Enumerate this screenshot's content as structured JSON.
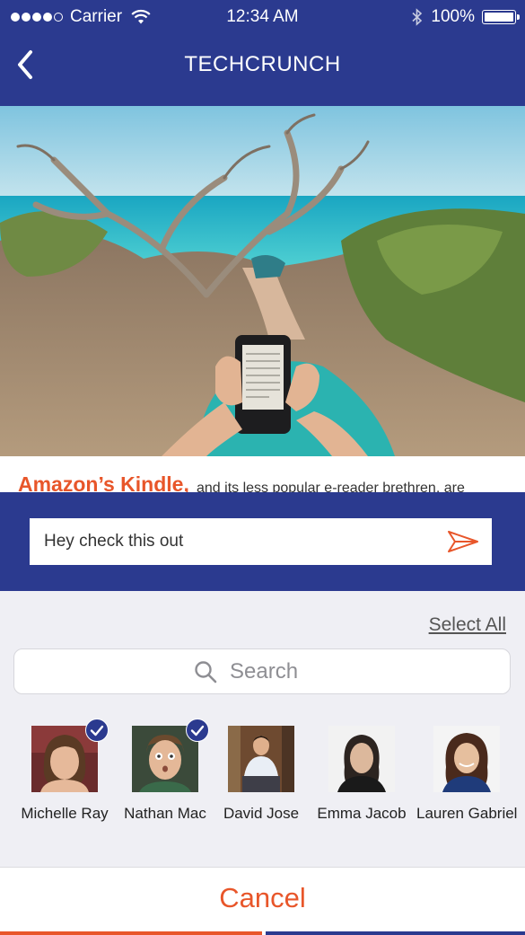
{
  "colors": {
    "brand": "#2b3a8f",
    "accent": "#e8562a",
    "sheet": "#efeff4"
  },
  "status": {
    "carrier": "Carrier",
    "time": "12:34 AM",
    "battery": "100%"
  },
  "nav": {
    "title": "TECHCRUNCH",
    "back_icon": "chevron-left-icon"
  },
  "article": {
    "lead": "Amazon’s Kindle,",
    "rest": "and its less popular e-reader brethren, are"
  },
  "share": {
    "message_value": "Hey check this out",
    "send_icon": "send-icon"
  },
  "picker": {
    "select_all": "Select All",
    "search_placeholder": "Search",
    "contacts": [
      {
        "name": "Michelle Ray",
        "selected": true
      },
      {
        "name": "Nathan Mac",
        "selected": true
      },
      {
        "name": "David Jose",
        "selected": false
      },
      {
        "name": "Emma Jacob",
        "selected": false
      },
      {
        "name": "Lauren Gabriel",
        "selected": false
      }
    ],
    "cancel": "Cancel"
  }
}
